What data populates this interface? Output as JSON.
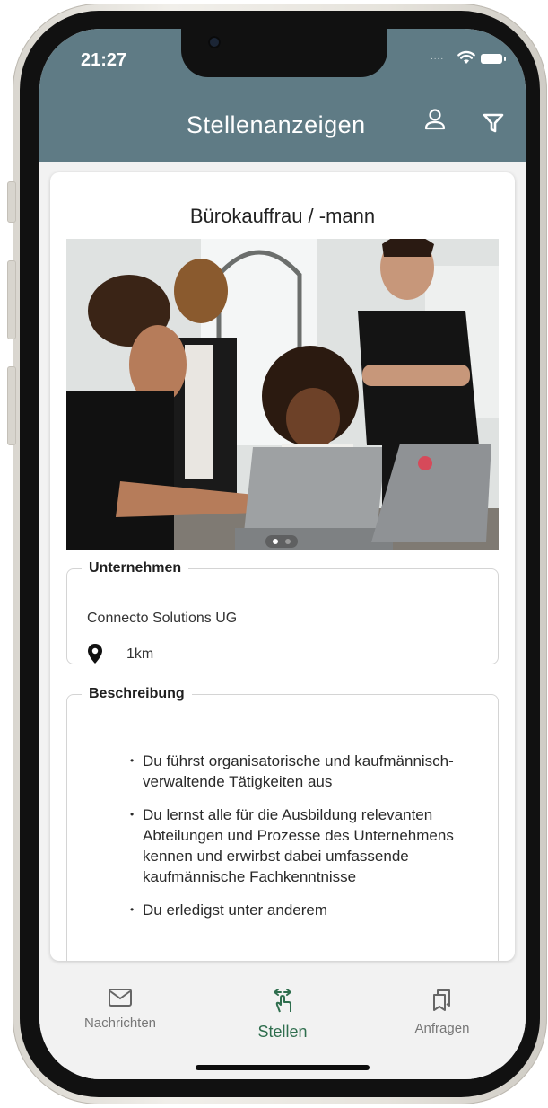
{
  "status_bar": {
    "time": "21:27",
    "signal": "....",
    "wifi_icon": "wifi-icon",
    "battery_icon": "battery-icon"
  },
  "header": {
    "title": "Stellenanzeigen",
    "profile_icon": "person-icon",
    "filter_icon": "filter-icon",
    "background_color": "#5f7b85"
  },
  "job": {
    "title": "Bürokauffrau / -mann",
    "image": "team-at-laptops-photo",
    "carousel_pages": 2,
    "carousel_active_index": 0,
    "company_section": {
      "legend": "Unternehmen",
      "name": "Connecto Solutions UG",
      "location_icon": "location-pin-icon",
      "distance": "1km"
    },
    "description_section": {
      "legend": "Beschreibung",
      "bullets": [
        "Du führst organisatorische und kaufmännisch-verwaltende Tätigkeiten aus",
        "Du lernst alle für die Ausbildung relevanten Abteilungen und Prozesse des Unternehmens kennen und erwirbst dabei umfassende kaufmännische Fachkenntnisse",
        "Du erledigst unter anderem"
      ]
    }
  },
  "bottom_nav": {
    "items": [
      {
        "label": "Nachrichten",
        "icon": "envelope-icon",
        "active": false
      },
      {
        "label": "Stellen",
        "icon": "swipe-hand-icon",
        "active": true
      },
      {
        "label": "Anfragen",
        "icon": "bookmarks-icon",
        "active": false
      }
    ],
    "active_color": "#2f6e4e"
  }
}
